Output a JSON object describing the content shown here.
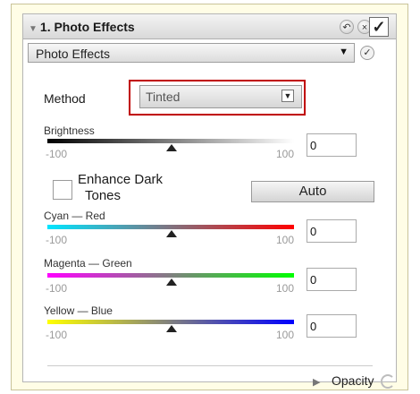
{
  "header": {
    "title": "1. Photo Effects",
    "undo_icon": "undo-icon",
    "close_icon": "close-icon",
    "check_glyph": "✓"
  },
  "effect_dropdown": {
    "value": "Photo Effects"
  },
  "method": {
    "label": "Method",
    "value": "Tinted"
  },
  "brightness": {
    "label": "Brightness",
    "min": "-100",
    "max": "100",
    "value": "0"
  },
  "enhance_dark_tones": {
    "label_line1": "Enhance Dark",
    "label_line2": "Tones",
    "checked": false
  },
  "auto_button": {
    "label": "Auto"
  },
  "cyan_red": {
    "label": "Cyan — Red",
    "min": "-100",
    "max": "100",
    "value": "0"
  },
  "magenta_green": {
    "label": "Magenta — Green",
    "min": "-100",
    "max": "100",
    "value": "0"
  },
  "yellow_blue": {
    "label": "Yellow — Blue",
    "min": "-100",
    "max": "100",
    "value": "0"
  },
  "opacity": {
    "label": "Opacity"
  },
  "colors": {
    "panel_bg": "#fffde6",
    "highlight": "#c00000",
    "cyan": "#00e5ff",
    "red": "#ff0000",
    "magenta": "#ff00ff",
    "green": "#00ff00",
    "yellow": "#ffff00",
    "blue": "#0000ff"
  }
}
